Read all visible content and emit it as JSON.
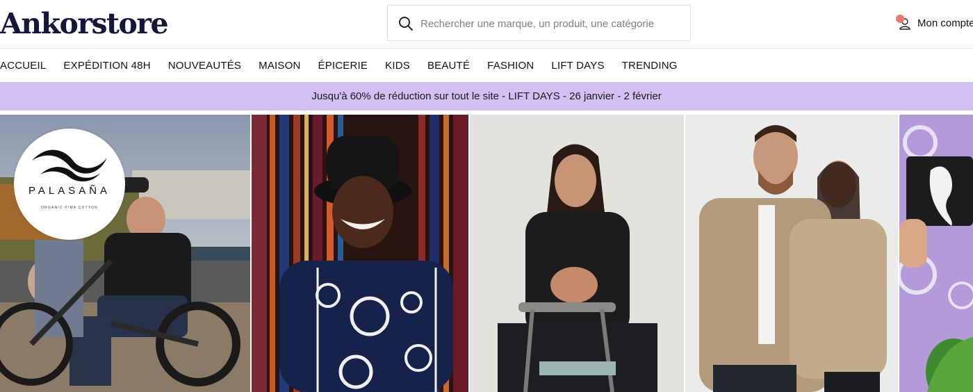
{
  "header": {
    "logo": "Ankorstore",
    "search": {
      "placeholder": "Rechercher une marque, un produit, une catégorie",
      "icon": "search-icon"
    },
    "account": {
      "label": "Mon compte",
      "icon": "user-icon"
    }
  },
  "nav": {
    "items": [
      {
        "label": "ACCUEIL"
      },
      {
        "label": "EXPÉDITION 48H"
      },
      {
        "label": "NOUVEAUTÉS"
      },
      {
        "label": "MAISON"
      },
      {
        "label": "ÉPICERIE"
      },
      {
        "label": "KIDS"
      },
      {
        "label": "BEAUTÉ"
      },
      {
        "label": "FASHION"
      },
      {
        "label": "LIFT DAYS"
      },
      {
        "label": "TRENDING"
      }
    ]
  },
  "promo_banner": {
    "text": "Jusqu'à 60% de réduction sur tout le site - LIFT DAYS - 26 janvier - 2 février"
  },
  "hero": {
    "brand": {
      "name": "PALASAÑA",
      "tagline": "ORGANIC PIMA COTTON"
    }
  },
  "colors": {
    "logo": "#14163a",
    "banner": "#d2bff4",
    "notification_dot": "#f07a6a"
  }
}
